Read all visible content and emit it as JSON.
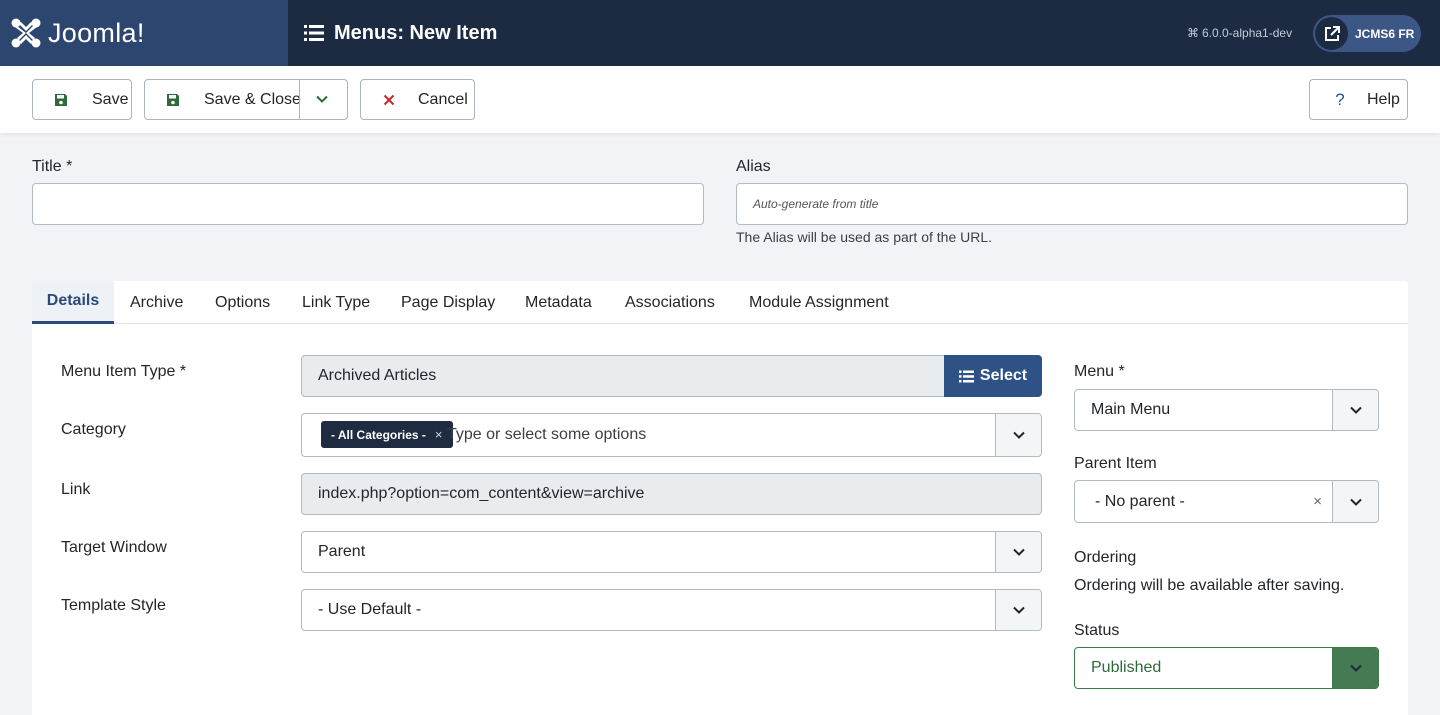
{
  "header": {
    "brand": "Joomla!",
    "page_title": "Menus: New Item",
    "version": "6.0.0-alpha1-dev",
    "site_button": "JCMS6 FR"
  },
  "toolbar": {
    "save": "Save",
    "save_close": "Save & Close",
    "cancel": "Cancel",
    "help": "Help"
  },
  "form": {
    "title_label": "Title *",
    "title_value": "",
    "alias_label": "Alias",
    "alias_placeholder": "Auto-generate from title",
    "alias_hint": "The Alias will be used as part of the URL."
  },
  "tabs": [
    "Details",
    "Archive",
    "Options",
    "Link Type",
    "Page Display",
    "Metadata",
    "Associations",
    "Module Assignment"
  ],
  "details": {
    "menu_item_type_label": "Menu Item Type *",
    "menu_item_type_value": "Archived Articles",
    "select_button": "Select",
    "category_label": "Category",
    "category_chip": "- All Categories -",
    "category_placeholder": "Type or select some options",
    "link_label": "Link",
    "link_value": "index.php?option=com_content&view=archive",
    "target_label": "Target Window",
    "target_value": "Parent",
    "template_label": "Template Style",
    "template_value": "- Use Default -"
  },
  "side": {
    "menu_label": "Menu *",
    "menu_value": "Main Menu",
    "parent_label": "Parent Item",
    "parent_value": "- No parent -",
    "ordering_label": "Ordering",
    "ordering_text": "Ordering will be available after saving.",
    "status_label": "Status",
    "status_value": "Published"
  },
  "colors": {
    "header_bg": "#1c2a42",
    "brand_bg": "#2c4670",
    "primary": "#2f5286",
    "status_green": "#467a52"
  }
}
